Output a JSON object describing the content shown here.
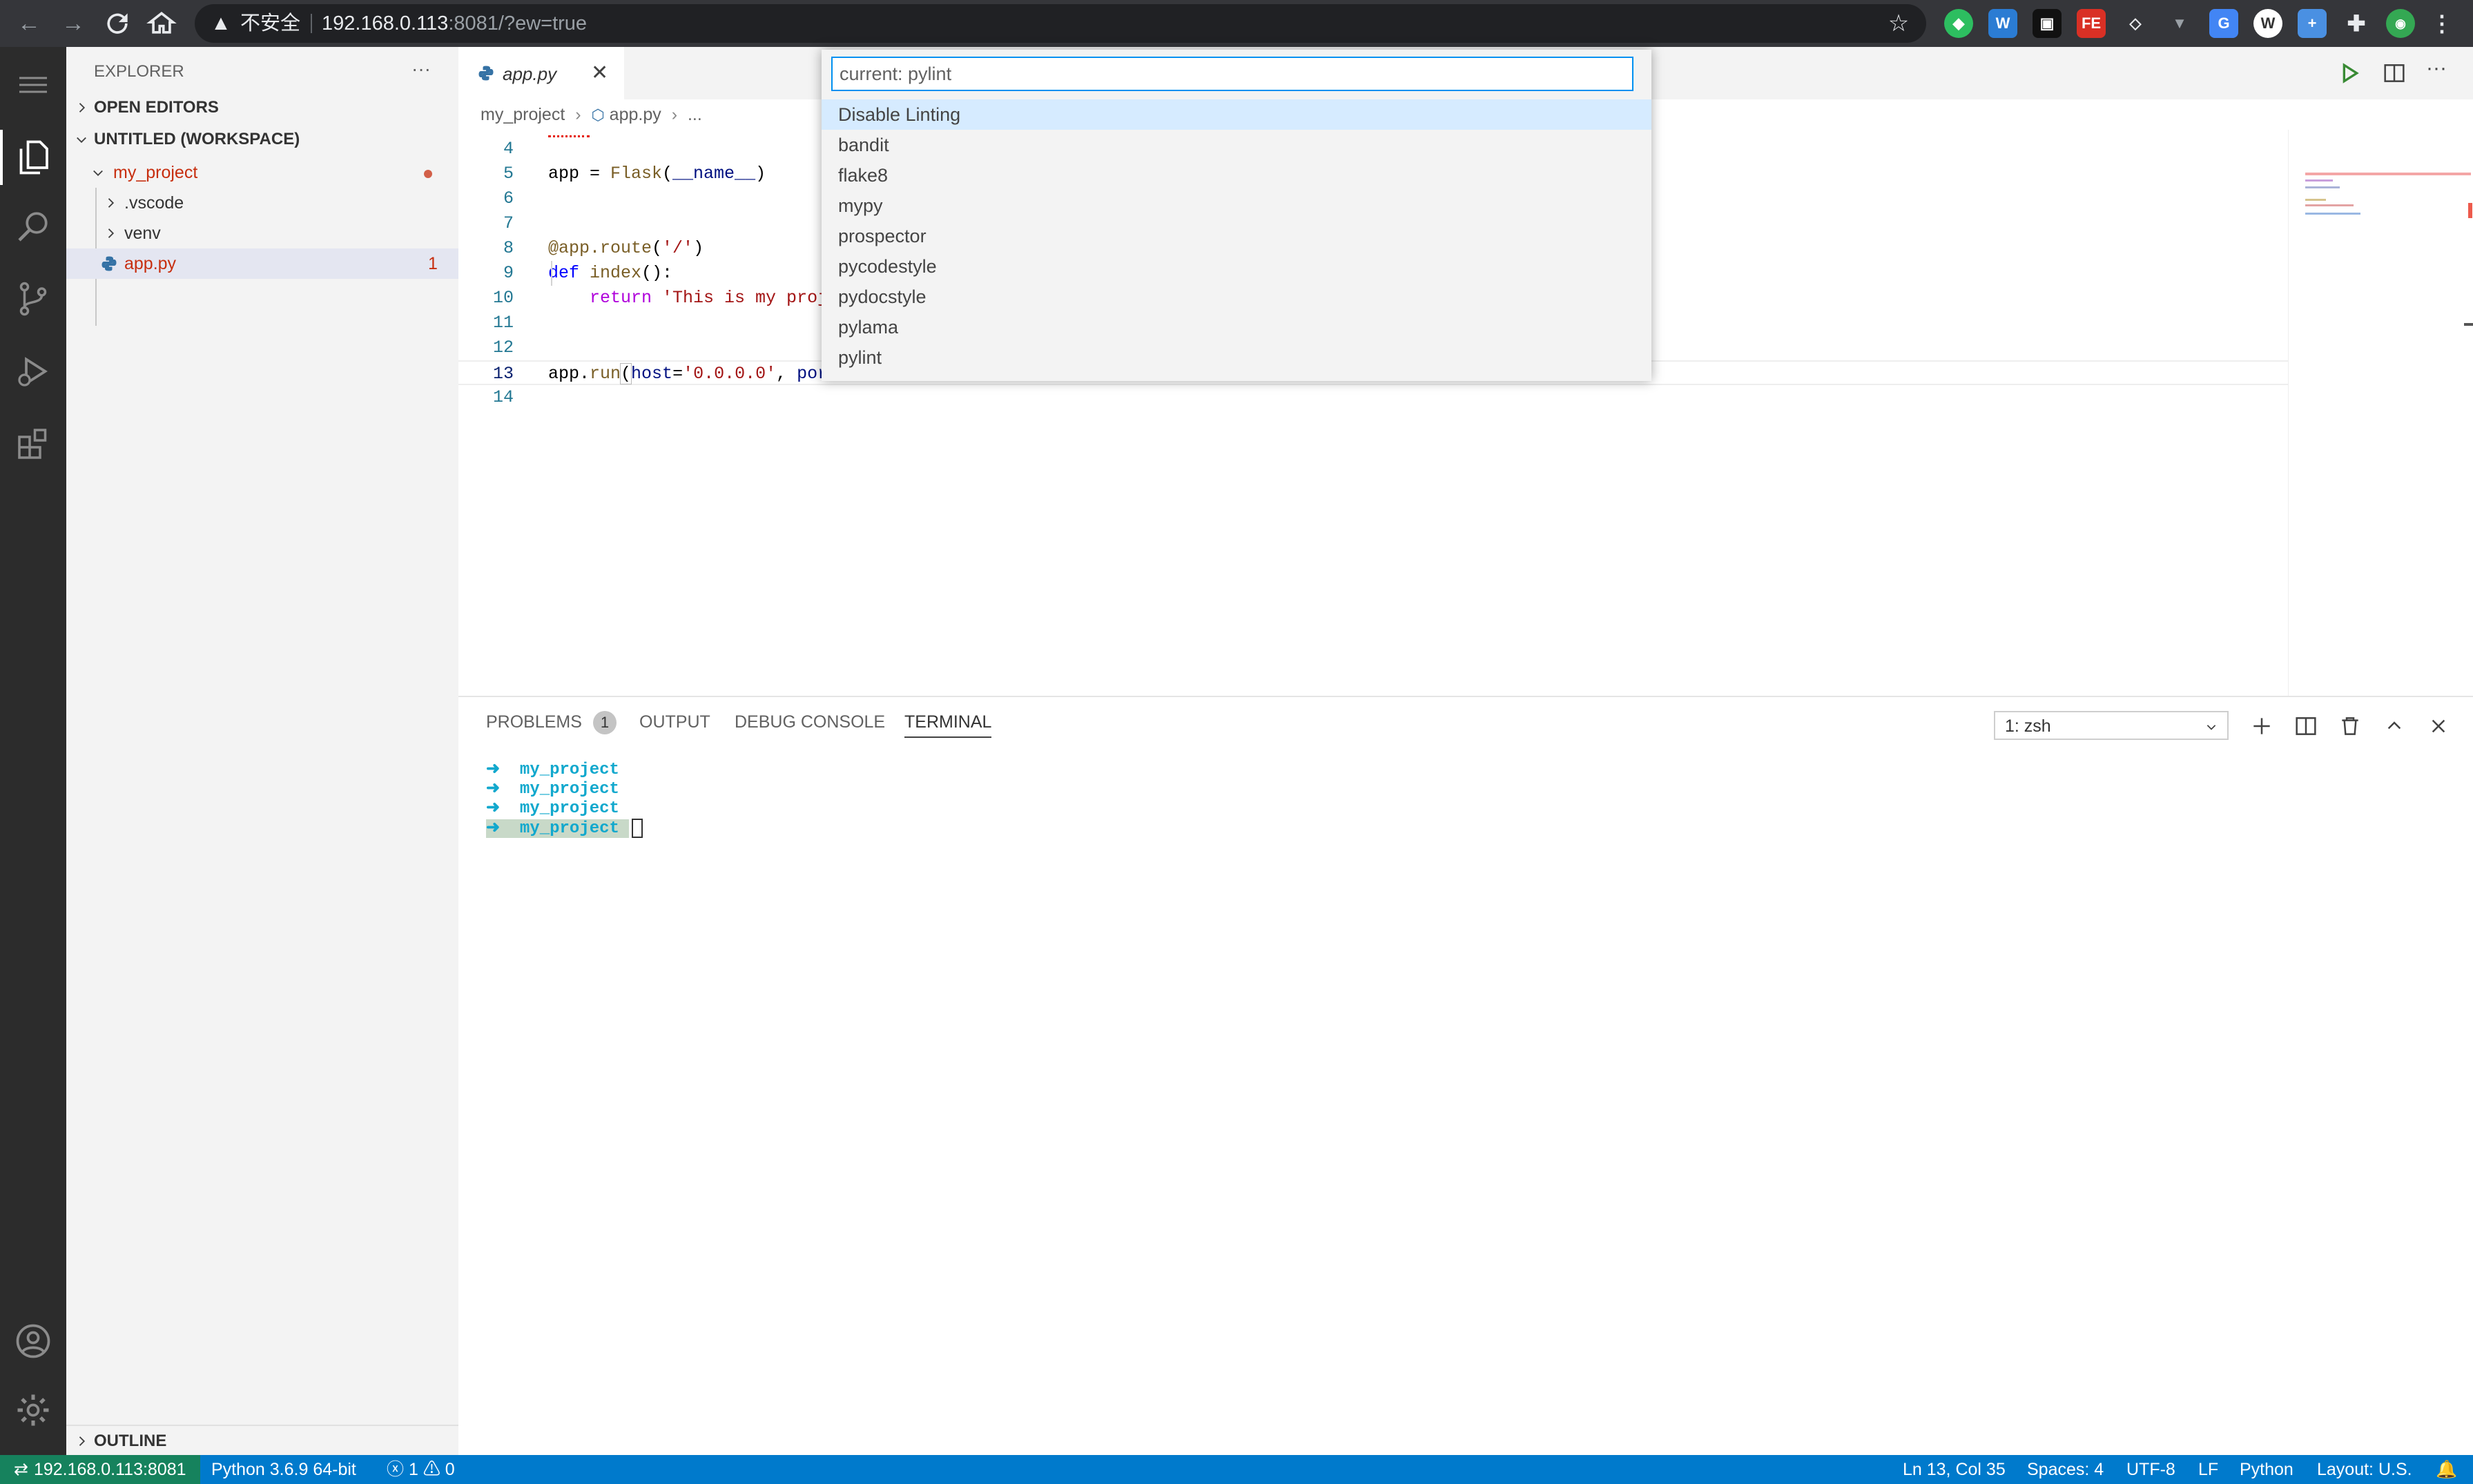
{
  "browser": {
    "security_label": "不安全",
    "url_host": "192.168.0.113",
    "url_rest": ":8081/?ew=true"
  },
  "explorer": {
    "title": "EXPLORER",
    "more": "···",
    "open_editors": "OPEN EDITORS",
    "workspace": "UNTITLED (WORKSPACE)",
    "tree": [
      {
        "label": "my_project"
      },
      {
        "label": ".vscode"
      },
      {
        "label": "venv"
      },
      {
        "label": "app.py",
        "badge": "1"
      }
    ],
    "outline": "OUTLINE"
  },
  "editor": {
    "tab_label": "app.py",
    "breadcrumb": [
      "my_project",
      "app.py",
      "..."
    ],
    "lines": [
      {
        "n": "4"
      },
      {
        "n": "5"
      },
      {
        "n": "6"
      },
      {
        "n": "7"
      },
      {
        "n": "8"
      },
      {
        "n": "9"
      },
      {
        "n": "10"
      },
      {
        "n": "11"
      },
      {
        "n": "12"
      },
      {
        "n": "13"
      },
      {
        "n": "14"
      }
    ],
    "code": {
      "l5_a": "app = ",
      "l5_b": "Flask",
      "l5_c": "(",
      "l5_d": "__name__",
      "l5_e": ")",
      "l8_a": "@app.route",
      "l8_b": "(",
      "l8_c": "'/'",
      "l8_d": ")",
      "l9_a": "def ",
      "l9_b": "index",
      "l9_c": "():",
      "l10_a": "return ",
      "l10_b": "'This is my proje",
      "l13_a": "app.",
      "l13_b": "run",
      "l13_c": "(",
      "l13_d": "host",
      "l13_e": "=",
      "l13_f": "'0.0.0.0'",
      "l13_g": ", ",
      "l13_h": "port"
    }
  },
  "quick_pick": {
    "input_value": "current: pylint",
    "items": [
      "Disable Linting",
      "bandit",
      "flake8",
      "mypy",
      "prospector",
      "pycodestyle",
      "pydocstyle",
      "pylama",
      "pylint"
    ]
  },
  "panel": {
    "tabs": [
      "PROBLEMS",
      "OUTPUT",
      "DEBUG CONSOLE",
      "TERMINAL"
    ],
    "problems_count": "1",
    "terminal_select": "1: zsh",
    "terminal_lines": [
      "➜  my_project",
      "➜  my_project",
      "➜  my_project",
      "➜  my_project "
    ]
  },
  "status": {
    "remote": "192.168.0.113:8081",
    "python": "Python 3.6.9 64-bit",
    "errors": "1",
    "warnings": "0",
    "position": "Ln 13, Col 35",
    "spaces": "Spaces: 4",
    "encoding": "UTF-8",
    "eol": "LF",
    "language": "Python",
    "layout": "Layout: U.S."
  },
  "colors": {
    "accent": "#007acc",
    "modified": "#c72e0f",
    "terminal_green": "#0dbc79",
    "terminal_cyan": "#11a8cd"
  }
}
